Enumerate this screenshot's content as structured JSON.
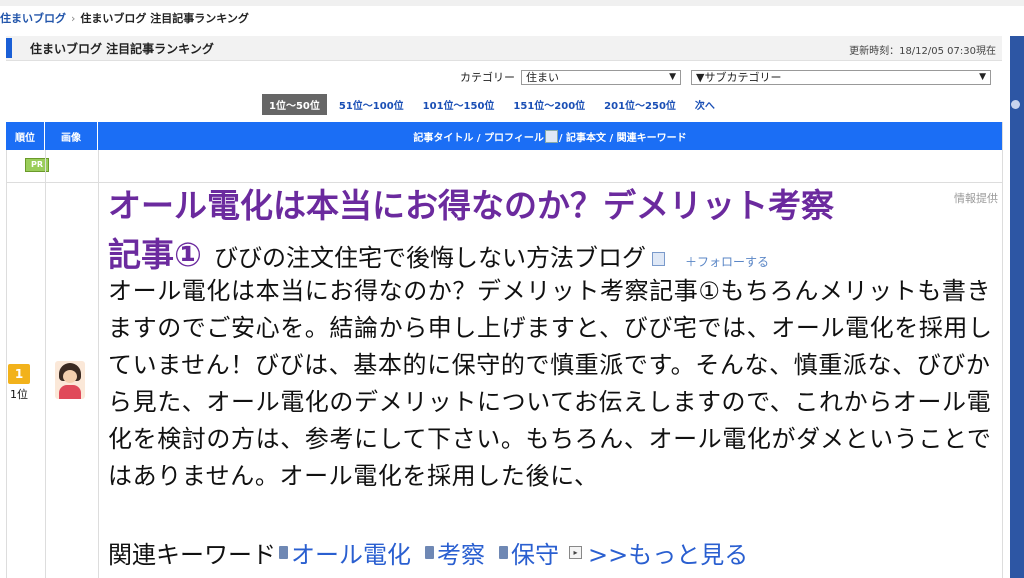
{
  "breadcrumb": {
    "root": "住まいブログ",
    "current": "住まいブログ 注目記事ランキング",
    "sep": "›"
  },
  "header": {
    "title": "住まいブログ 注目記事ランキング",
    "updated": "更新時刻：18/12/05 07:30現在"
  },
  "filters": {
    "category_label": "カテゴリー",
    "category_value": "住まい",
    "subcategory_value": "▼サブカテゴリー",
    "arrow": "▼"
  },
  "pager": {
    "items": [
      "1位～50位",
      "51位～100位",
      "101位～150位",
      "151位～200位",
      "201位～250位",
      "次へ"
    ],
    "active_index": 0
  },
  "table_header": {
    "rank": "順位",
    "image": "画像",
    "title_a": "記事タイトル / プロフィール",
    "title_b": " / 記事本文 / 関連キーワード"
  },
  "pr_badge": "PR",
  "entry": {
    "rank_number": "1",
    "rank_label": "1位",
    "title_line1": "オール電化は本当にお得なのか？デメリット考察",
    "title_line2": "記事①",
    "blog_name": "びびの注文住宅で後悔しない方法ブログ",
    "follow": "フォローする",
    "info_provided": "情報提供",
    "body": "オール電化は本当にお得なのか？デメリット考察記事①もちろんメリットも書きますのでご安心を。結論から申し上げますと、びび宅では、オール電化を採用していません！びびは、基本的に保守的で慎重派です。そんな、慎重派な、びびから見た、オール電化のデメリットについてお伝えしますので、これからオール電化を検討の方は、参考にして下さい。もちろん、オール電化がダメということではありません。オール電化を採用した後に、",
    "keywords_label": "関連キーワード",
    "keywords": [
      "オール電化",
      "考察",
      "保守"
    ],
    "more": ">>もっと見る"
  },
  "colors": {
    "accent": "#1b6ef5",
    "title_purple": "#6b2a9e",
    "link": "#2a5fd0"
  }
}
